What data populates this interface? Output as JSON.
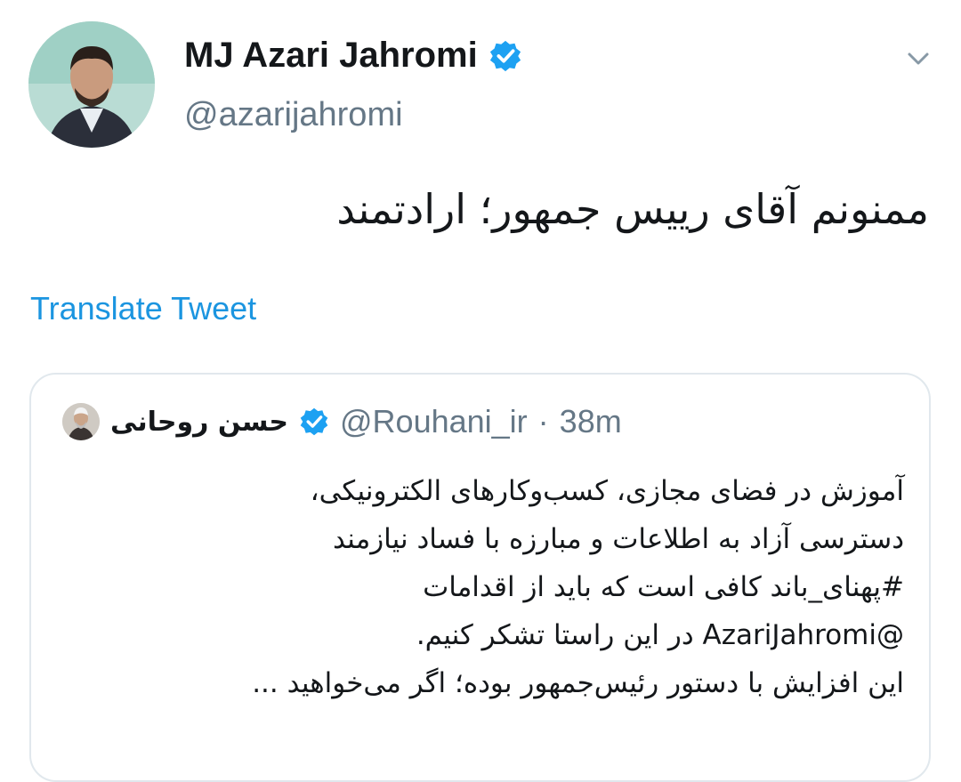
{
  "tweet": {
    "author_name": "MJ Azari Jahromi",
    "author_handle": "@azarijahromi",
    "text": "ممنونم آقای رییس جمهور؛ ارادتمند",
    "translate_label": "Translate Tweet",
    "icons": {
      "avatar": "author-photo",
      "verified": "verified-badge-icon",
      "menu": "chevron-down-icon"
    }
  },
  "quoted": {
    "author_name": "حسن روحانی",
    "author_handle": "@Rouhani_ir",
    "separator": "·",
    "time": "38m",
    "lines": [
      "آموزش در فضای مجازی، کسب‌وکارهای الکترونیکی،",
      "دسترسی آزاد به اطلاعات و مبارزه با فساد نیازمند",
      "#پهنای_باند کافی است که باید از اقدامات",
      "@AzariJahromi در این راستا تشکر کنیم.",
      "این افزایش با دستور رئیس‌جمهور بوده؛ اگر می‌خواهید ..."
    ]
  },
  "colors": {
    "link": "#1b95e0",
    "muted": "#657786",
    "verified": "#1da1f2",
    "border": "#e1e8ed"
  }
}
